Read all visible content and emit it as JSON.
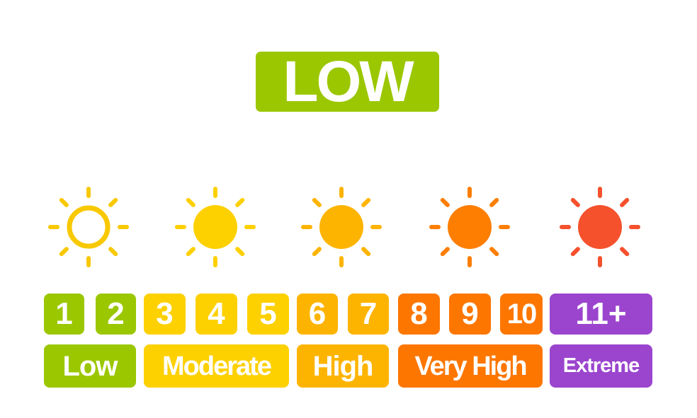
{
  "current_level": {
    "label": "LOW",
    "color": "#9BC700"
  },
  "suns": [
    {
      "icon": "sun-outline-icon",
      "color": "#F8C800",
      "filled": false
    },
    {
      "icon": "sun-filled-icon",
      "color": "#FDD000",
      "filled": true
    },
    {
      "icon": "sun-filled-icon",
      "color": "#FDB400",
      "filled": true
    },
    {
      "icon": "sun-filled-icon",
      "color": "#FD7E00",
      "filled": true
    },
    {
      "icon": "sun-filled-icon",
      "color": "#F4512C",
      "filled": true
    }
  ],
  "index_tiles": [
    {
      "value": "1",
      "color": "#9BC700"
    },
    {
      "value": "2",
      "color": "#9BC700"
    },
    {
      "value": "3",
      "color": "#FDD000"
    },
    {
      "value": "4",
      "color": "#FDD000"
    },
    {
      "value": "5",
      "color": "#FDD000"
    },
    {
      "value": "6",
      "color": "#FDB400"
    },
    {
      "value": "7",
      "color": "#FDB400"
    },
    {
      "value": "8",
      "color": "#FD7600"
    },
    {
      "value": "9",
      "color": "#FD7600"
    },
    {
      "value": "10",
      "color": "#FD7600"
    },
    {
      "value": "11+",
      "color": "#9B45CE"
    }
  ],
  "category_labels": [
    {
      "text": "Low",
      "color": "#9BC700"
    },
    {
      "text": "Moderate",
      "color": "#FDD000"
    },
    {
      "text": "High",
      "color": "#FDB400"
    },
    {
      "text": "Very High",
      "color": "#FD7600"
    },
    {
      "text": "Extreme",
      "color": "#9B45CE"
    }
  ]
}
